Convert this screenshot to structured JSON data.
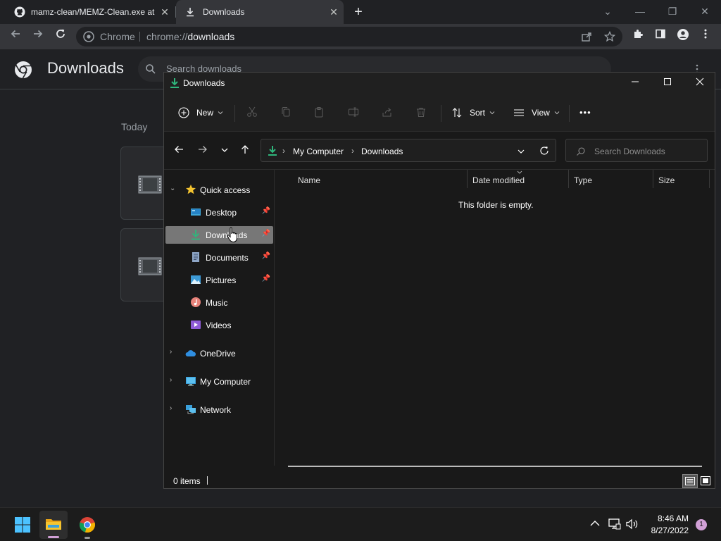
{
  "browser": {
    "tabs": [
      {
        "title": "mamz-clean/MEMZ-Clean.exe at",
        "close": "✕"
      },
      {
        "title": "Downloads",
        "close": "✕"
      }
    ],
    "new_tab": "+",
    "window_controls": {
      "tab_search": "⌄",
      "minimize": "—",
      "restore": "❐",
      "close": "✕"
    },
    "omnibox": {
      "site_label": "Chrome",
      "url_scheme": "chrome://",
      "url_host": "downloads"
    }
  },
  "downloads_page": {
    "title": "Downloads",
    "search_placeholder": "Search downloads",
    "section_label": "Today"
  },
  "explorer": {
    "title": "Downloads",
    "commands": {
      "new": "New",
      "sort": "Sort",
      "view": "View",
      "more": "•••"
    },
    "breadcrumb": [
      "My Computer",
      "Downloads"
    ],
    "search_placeholder": "Search Downloads",
    "nav": {
      "quick_access": "Quick access",
      "pinned": [
        {
          "label": "Desktop",
          "pinned": true
        },
        {
          "label": "Downloads",
          "pinned": true,
          "selected": true
        },
        {
          "label": "Documents",
          "pinned": true
        },
        {
          "label": "Pictures",
          "pinned": true
        },
        {
          "label": "Music",
          "pinned": false
        },
        {
          "label": "Videos",
          "pinned": false
        }
      ],
      "onedrive": "OneDrive",
      "my_computer": "My Computer",
      "network": "Network"
    },
    "columns": [
      "Name",
      "Date modified",
      "Type",
      "Size"
    ],
    "empty_message": "This folder is empty.",
    "status": "0 items"
  },
  "taskbar": {
    "time": "8:46 AM",
    "date": "8/27/2022",
    "notification_count": "1"
  },
  "colors": {
    "accent_green": "#2fb67c",
    "folder_yellow": "#f4c430",
    "selected_bg": "#777777"
  }
}
